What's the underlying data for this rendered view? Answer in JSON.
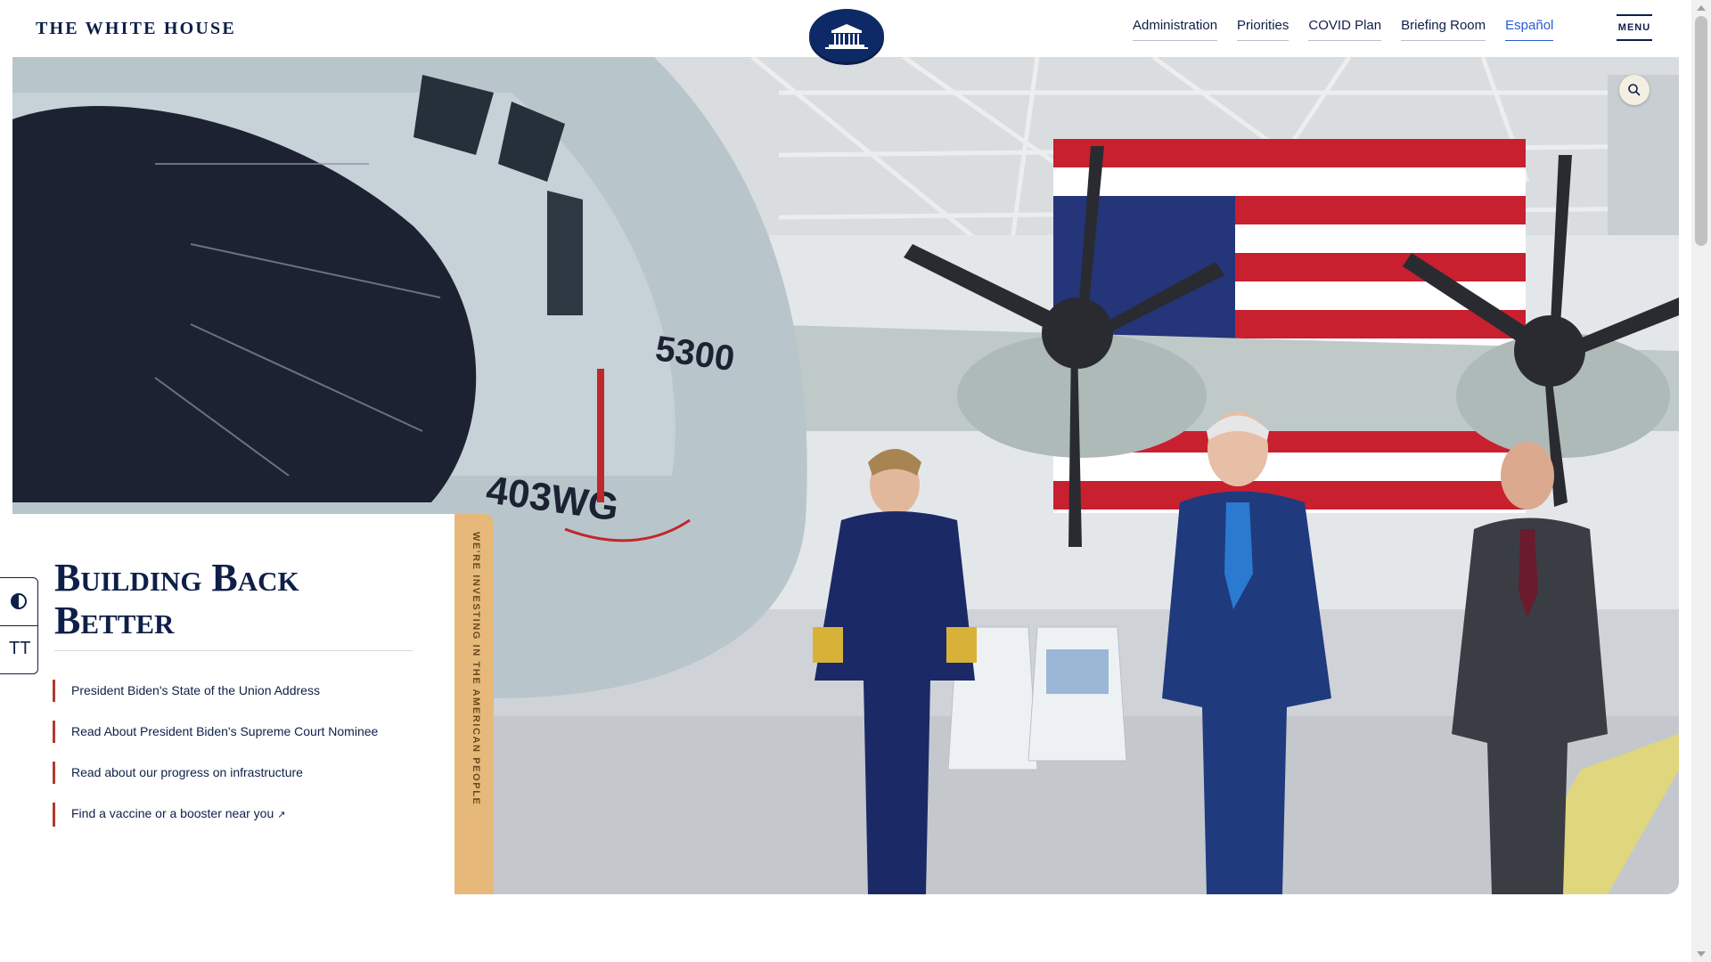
{
  "header": {
    "brand": "THE WHITE HOUSE",
    "nav": [
      {
        "label": "Administration"
      },
      {
        "label": "Priorities"
      },
      {
        "label": "COVID Plan"
      },
      {
        "label": "Briefing Room"
      },
      {
        "label": "Español"
      }
    ],
    "menu_label": "MENU",
    "seal_icon": "white-house-seal-icon"
  },
  "hero": {
    "image_alt": "President Biden walking in an aircraft hangar with Coast Guard leadership in front of an HC-130J aircraft and American flag",
    "search_icon": "search-icon"
  },
  "feature": {
    "title": "Building Back Better",
    "strip_text": "WE'RE INVESTING IN THE AMERICAN PEOPLE",
    "links": [
      {
        "label": "President Biden's State of the Union Address",
        "external": false
      },
      {
        "label": "Read About President Biden's Supreme Court Nominee",
        "external": false
      },
      {
        "label": "Read about our progress on infrastructure",
        "external": false
      },
      {
        "label": "Find a vaccine or a booster near you",
        "external": true
      }
    ]
  },
  "accessibility": {
    "contrast_icon": "contrast-icon",
    "text_size_label": "TT",
    "text_size_icon": "text-size-icon"
  },
  "colors": {
    "navy": "#0e1f48",
    "accent_gold": "#e6b97b",
    "link_rule": "#b03b2e",
    "lang_link": "#2a5bd7"
  }
}
